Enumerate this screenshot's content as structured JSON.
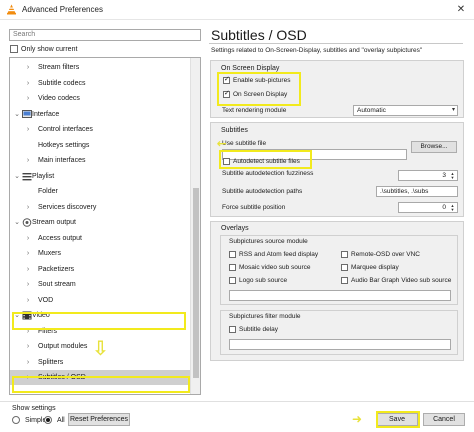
{
  "window": {
    "title": "Advanced Preferences",
    "close_glyph": "✕"
  },
  "left_pane": {
    "search_placeholder": "Search",
    "only_show_current": "Only show current",
    "tree": [
      {
        "label": "Stream filters",
        "level": 2,
        "chevron": "›",
        "icon": "none"
      },
      {
        "label": "Subtitle codecs",
        "level": 2,
        "chevron": "›",
        "icon": "none"
      },
      {
        "label": "Video codecs",
        "level": 2,
        "chevron": "›",
        "icon": "none"
      },
      {
        "label": "Interface",
        "level": 1,
        "chevron": "⌄",
        "icon": "interface-icon"
      },
      {
        "label": "Control interfaces",
        "level": 2,
        "chevron": "›",
        "icon": "none"
      },
      {
        "label": "Hotkeys settings",
        "level": 2,
        "chevron": "",
        "icon": "none"
      },
      {
        "label": "Main interfaces",
        "level": 2,
        "chevron": "›",
        "icon": "none"
      },
      {
        "label": "Playlist",
        "level": 1,
        "chevron": "⌄",
        "icon": "playlist-icon"
      },
      {
        "label": "Folder",
        "level": 2,
        "chevron": "",
        "icon": "none"
      },
      {
        "label": "Services discovery",
        "level": 2,
        "chevron": "›",
        "icon": "none"
      },
      {
        "label": "Stream output",
        "level": 1,
        "chevron": "⌄",
        "icon": "stream-output-icon"
      },
      {
        "label": "Access output",
        "level": 2,
        "chevron": "›",
        "icon": "none"
      },
      {
        "label": "Muxers",
        "level": 2,
        "chevron": "›",
        "icon": "none"
      },
      {
        "label": "Packetizers",
        "level": 2,
        "chevron": "›",
        "icon": "none"
      },
      {
        "label": "Sout stream",
        "level": 2,
        "chevron": "›",
        "icon": "none"
      },
      {
        "label": "VOD",
        "level": 2,
        "chevron": "›",
        "icon": "none"
      },
      {
        "label": "Video",
        "level": 1,
        "chevron": "⌄",
        "icon": "video-icon"
      },
      {
        "label": "Filters",
        "level": 2,
        "chevron": "›",
        "icon": "none"
      },
      {
        "label": "Output modules",
        "level": 2,
        "chevron": "›",
        "icon": "none"
      },
      {
        "label": "Splitters",
        "level": 2,
        "chevron": "›",
        "icon": "none"
      },
      {
        "label": "Subtitles / OSD",
        "level": 2,
        "chevron": "›",
        "icon": "none",
        "selected": true
      }
    ],
    "show_settings_label": "Show settings",
    "radio_simple": "Simple",
    "radio_all": "All",
    "reset_button": "Reset Preferences"
  },
  "right_pane": {
    "title": "Subtitles / OSD",
    "description": "Settings related to On-Screen-Display, subtitles and \"overlay subpictures\"",
    "osd_group": {
      "title": "On Screen Display",
      "enable_subpictures": "Enable sub-pictures",
      "on_screen_display": "On Screen Display",
      "text_rendering_label": "Text rendering module",
      "text_rendering_value": "Automatic"
    },
    "subtitles_group": {
      "title": "Subtitles",
      "use_subtitle_file": "Use subtitle file",
      "browse_button": "Browse...",
      "autodetect": "Autodetect subtitle files",
      "fuzziness_label": "Subtitle autodetection fuzziness",
      "fuzziness_value": "3",
      "paths_label": "Subtitle autodetection paths",
      "paths_value": ".\\subtitles, .\\subs",
      "force_position_label": "Force subtitle position",
      "force_position_value": "0"
    },
    "overlays_group": {
      "title": "Overlays",
      "source_module_title": "Subpictures source module",
      "options": [
        {
          "label": "RSS and Atom feed display",
          "checked": false
        },
        {
          "label": "Remote-OSD over VNC",
          "checked": false
        },
        {
          "label": "Mosaic video sub source",
          "checked": false
        },
        {
          "label": "Marquee display",
          "checked": false
        },
        {
          "label": "Logo sub source",
          "checked": false
        },
        {
          "label": "Audio Bar Graph Video sub source",
          "checked": false
        }
      ],
      "filter_module_title": "Subpictures filter module",
      "subtitle_delay": "Subtitle delay"
    },
    "save_button": "Save",
    "cancel_button": "Cancel"
  },
  "colors": {
    "highlight": "#f2ea1d",
    "selection": "#cfcfcf",
    "group_bg": "#f0f0f0"
  }
}
